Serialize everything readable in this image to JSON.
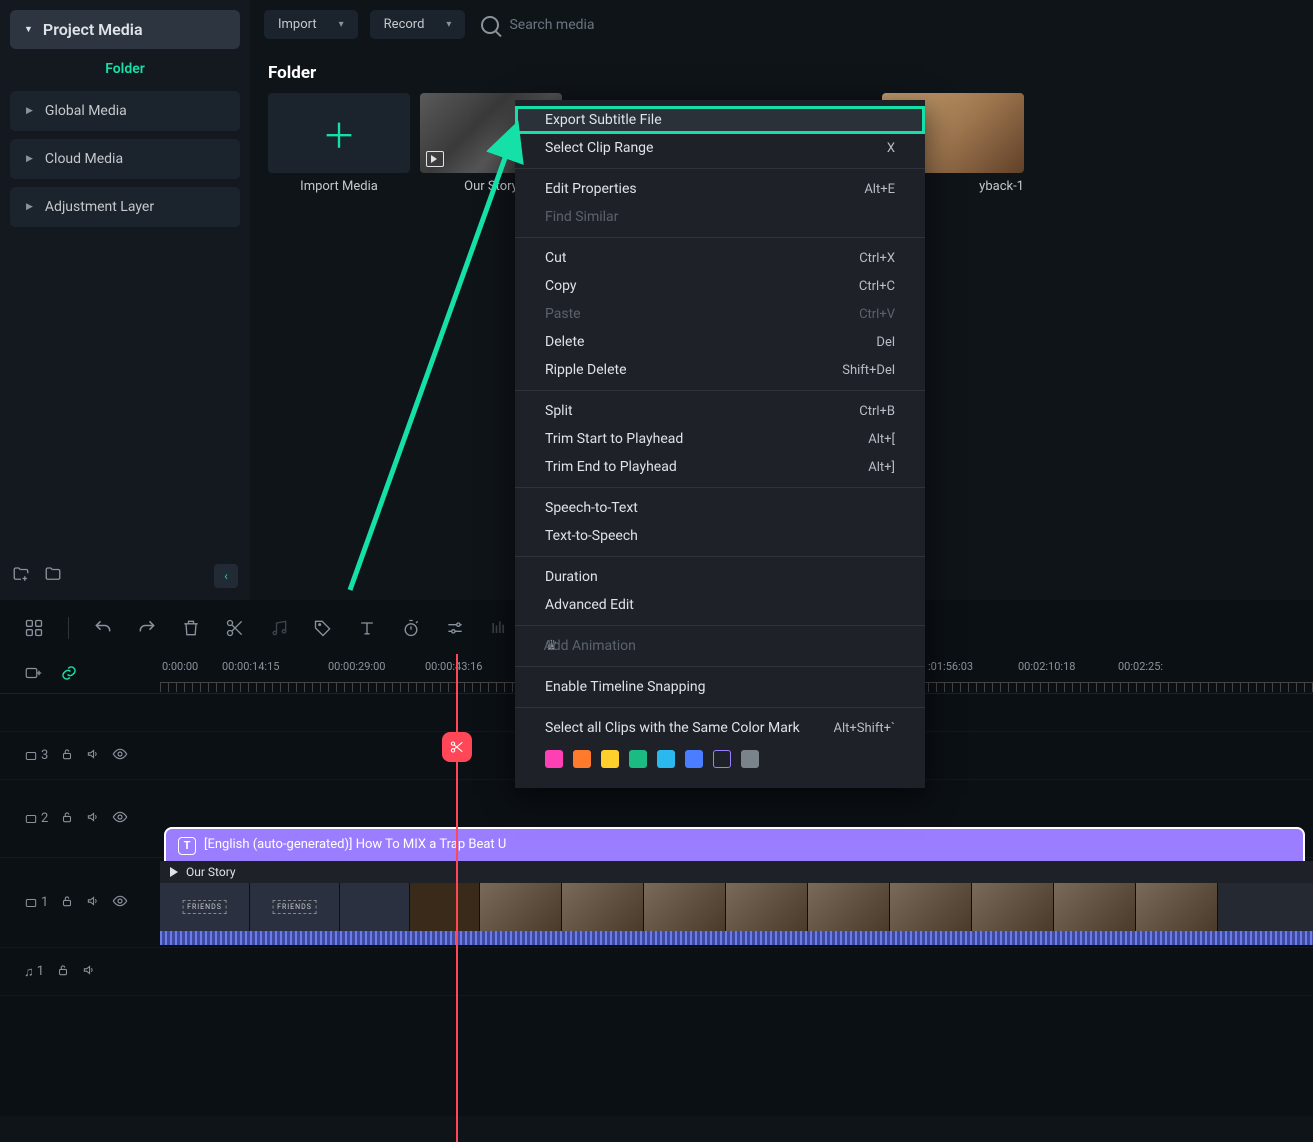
{
  "sidebar": {
    "project_media": "Project Media",
    "folder": "Folder",
    "items": [
      {
        "label": "Global Media"
      },
      {
        "label": "Cloud Media"
      },
      {
        "label": "Adjustment Layer"
      }
    ]
  },
  "toolbar": {
    "import": "Import",
    "record": "Record",
    "search_placeholder": "Search media"
  },
  "breadcrumb": "Folder",
  "media": [
    {
      "label": "Import Media",
      "type": "import"
    },
    {
      "label": "Our Story",
      "type": "video-mono"
    },
    {
      "label": "yback-1",
      "type": "video-orange"
    }
  ],
  "context_menu": {
    "groups": [
      [
        {
          "label": "Export Subtitle File",
          "shortcut": "",
          "highlighted": true
        },
        {
          "label": "Select Clip Range",
          "shortcut": "X"
        }
      ],
      [
        {
          "label": "Edit Properties",
          "shortcut": "Alt+E"
        },
        {
          "label": "Find Similar",
          "shortcut": "",
          "disabled": true
        }
      ],
      [
        {
          "label": "Cut",
          "shortcut": "Ctrl+X"
        },
        {
          "label": "Copy",
          "shortcut": "Ctrl+C"
        },
        {
          "label": "Paste",
          "shortcut": "Ctrl+V",
          "disabled": true
        },
        {
          "label": "Delete",
          "shortcut": "Del"
        },
        {
          "label": "Ripple Delete",
          "shortcut": "Shift+Del"
        }
      ],
      [
        {
          "label": "Split",
          "shortcut": "Ctrl+B"
        },
        {
          "label": "Trim Start to Playhead",
          "shortcut": "Alt+["
        },
        {
          "label": "Trim End to Playhead",
          "shortcut": "Alt+]"
        }
      ],
      [
        {
          "label": "Speech-to-Text",
          "shortcut": ""
        },
        {
          "label": "Text-to-Speech",
          "shortcut": ""
        }
      ],
      [
        {
          "label": "Duration",
          "shortcut": ""
        },
        {
          "label": "Advanced Edit",
          "shortcut": ""
        }
      ],
      [
        {
          "label": "Add Animation",
          "shortcut": "",
          "disabled": true,
          "crown": true
        }
      ],
      [
        {
          "label": "Enable Timeline Snapping",
          "shortcut": ""
        }
      ],
      [
        {
          "label": "Select all Clips with the Same Color Mark",
          "shortcut": "Alt+Shift+`"
        }
      ]
    ],
    "colors": [
      "#ff3fb4",
      "#ff7a2d",
      "#ffd02d",
      "#1abc83",
      "#2bb8ef",
      "#4a7dff",
      "outlined",
      "#7a828a"
    ]
  },
  "timeline": {
    "ruler": [
      "0:00:00",
      "00:00:14:15",
      "00:00:29:00",
      "00:00:43:16",
      ":01:56:03",
      "00:02:10:18",
      "00:02:25:"
    ],
    "tracks": {
      "track3": {
        "icon": "□",
        "num": "3"
      },
      "track2": {
        "icon": "□",
        "num": "2"
      },
      "track1": {
        "icon": "□",
        "num": "1"
      },
      "audio1": {
        "icon": "♫",
        "num": "1"
      }
    },
    "subtitle_clip": "[English (auto-generated)] How To MIX a Trap Beat U",
    "video_clip_title": "Our Story"
  }
}
